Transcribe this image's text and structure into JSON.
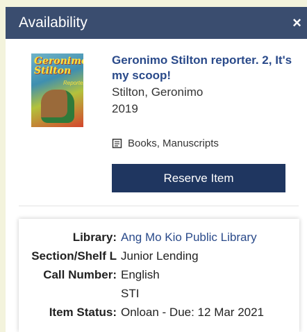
{
  "header": {
    "title": "Availability",
    "close_glyph": "×"
  },
  "book": {
    "title": "Geronimo Stilton reporter. 2, It's my scoop!",
    "author": "Stilton, Geronimo",
    "year": "2019",
    "format": "Books, Manuscripts",
    "cover_text": {
      "title": "Geronimo Stilton",
      "sub": "Reporter"
    }
  },
  "actions": {
    "reserve_label": "Reserve Item"
  },
  "holdings": {
    "library_label": "Library:",
    "library_value": "Ang Mo Kio Public Library",
    "section_label": "Section/Shelf L",
    "section_value": "Junior Lending",
    "call_label": "Call Number:",
    "call_value_1": "English",
    "call_value_2": "STI",
    "status_label": "Item Status:",
    "status_value": "Onloan - Due: 12 Mar 2021"
  },
  "colors": {
    "header": "#3a4d6f",
    "button": "#1f3660",
    "link": "#2a4a8a",
    "page": "#f3f3dc"
  }
}
